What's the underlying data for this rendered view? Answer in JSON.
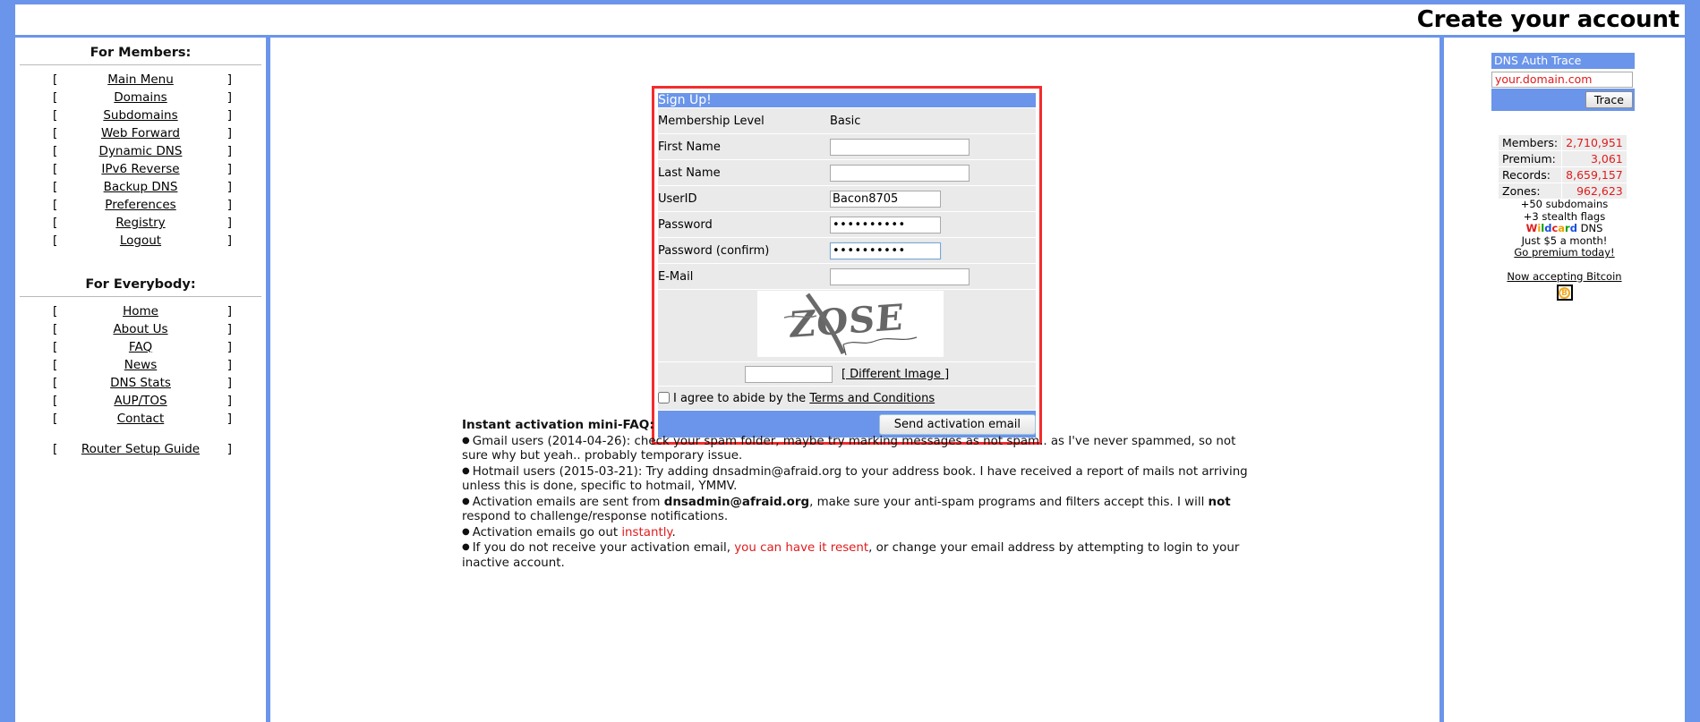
{
  "header": {
    "title": "Create your account"
  },
  "sidebar": {
    "members_heading": "For Members:",
    "everybody_heading": "For Everybody:",
    "bracket_left": "[",
    "bracket_right": "]",
    "members_items": [
      "Main Menu",
      "Domains",
      "Subdomains",
      "Web Forward",
      "Dynamic DNS",
      "IPv6 Reverse",
      "Backup DNS",
      "Preferences",
      "Registry",
      "Logout"
    ],
    "everybody_items": [
      "Home",
      "About Us",
      "FAQ",
      "News",
      "DNS Stats",
      "AUP/TOS",
      "Contact"
    ],
    "extra_items": [
      "Router Setup Guide"
    ]
  },
  "signup": {
    "title": "Sign Up!",
    "membership_label": "Membership Level",
    "membership_value": "Basic",
    "first_name_label": "First Name",
    "first_name_value": "",
    "last_name_label": "Last Name",
    "last_name_value": "",
    "userid_label": "UserID",
    "userid_value": "Bacon8705",
    "password_label": "Password",
    "password_value": "••••••••••",
    "password_confirm_label": "Password (confirm)",
    "password_confirm_value": "••••••••••",
    "email_label": "E-Mail",
    "email_value": "",
    "captcha_text": "ZOSE",
    "captcha_input_value": "",
    "different_image_label": "[ Different Image ]",
    "terms_prefix": "I agree to abide by the ",
    "terms_link": "Terms and Conditions",
    "terms_checked": false,
    "submit_label": "Send activation email",
    "border_color": "#f42c2c",
    "accent_color": "#6a95ea"
  },
  "faq": {
    "title": "Instant activation mini-FAQ:",
    "items": [
      {
        "parts": [
          {
            "t": "Gmail users (2014-04-26): check your spam folder, maybe try marking messages as not spam.. as I've never spammed, so not sure why but yeah.. probably temporary issue.",
            "style": "plain"
          }
        ]
      },
      {
        "parts": [
          {
            "t": "Hotmail users (2015-03-21): Try adding dnsadmin@afraid.org to your address book. I have received a report of mails not arriving unless this is done, specific to hotmail, YMMV.",
            "style": "plain"
          }
        ]
      },
      {
        "parts": [
          {
            "t": "Activation emails are sent from ",
            "style": "plain"
          },
          {
            "t": "dnsadmin@afraid.org",
            "style": "bold"
          },
          {
            "t": ", make sure your anti-spam programs and filters accept this. I will ",
            "style": "plain"
          },
          {
            "t": "not",
            "style": "bold"
          },
          {
            "t": " respond to challenge/response notifications.",
            "style": "plain"
          }
        ]
      },
      {
        "parts": [
          {
            "t": "Activation emails go out ",
            "style": "plain"
          },
          {
            "t": "instantly",
            "style": "red"
          },
          {
            "t": ".",
            "style": "plain"
          }
        ]
      },
      {
        "parts": [
          {
            "t": "If you do not receive your activation email, ",
            "style": "plain"
          },
          {
            "t": "you can have it resent",
            "style": "red"
          },
          {
            "t": ", or change your email address by attempting to login to your inactive account.",
            "style": "plain"
          }
        ]
      }
    ]
  },
  "trace": {
    "heading": "DNS Auth Trace",
    "domain_value": "your.domain.com",
    "domain_placeholder": "your.domain.com",
    "button_label": "Trace"
  },
  "stats": {
    "rows": [
      {
        "key": "Members:",
        "value": "2,710,951"
      },
      {
        "key": "Premium:",
        "value": "3,061"
      },
      {
        "key": "Records:",
        "value": "8,659,157"
      },
      {
        "key": "Zones:",
        "value": "962,623"
      }
    ],
    "value_color": "#e01b1b"
  },
  "promo": {
    "line1": "+50 subdomains",
    "line2": "+3 stealth flags",
    "wildcard_word": "Wildcard",
    "wildcard_suffix": " DNS",
    "line4": "Just $5 a month!",
    "link": "Go premium today!",
    "bitcoin_link": "Now accepting Bitcoin",
    "bitcoin_glyph": "B"
  }
}
